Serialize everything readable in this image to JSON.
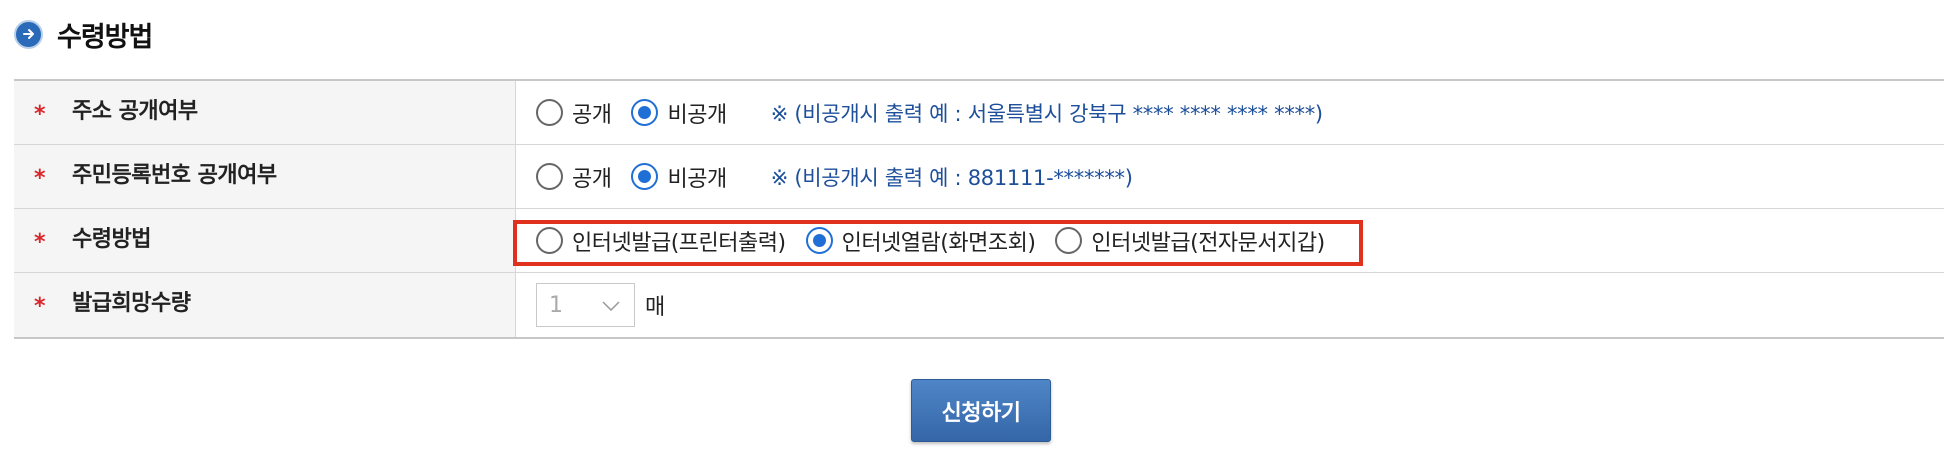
{
  "section": {
    "title": "수령방법"
  },
  "rows": [
    {
      "label": "주소 공개여부",
      "options": [
        "공개",
        "비공개"
      ],
      "selected": 1,
      "note": "※ (비공개시 출력 예 : 서울특별시 강북구 **** **** **** ****)"
    },
    {
      "label": "주민등록번호 공개여부",
      "options": [
        "공개",
        "비공개"
      ],
      "selected": 1,
      "note": "※ (비공개시 출력 예 : 881111-*******)"
    },
    {
      "label": "수령방법",
      "options": [
        "인터넷발급(프린터출력)",
        "인터넷열람(화면조회)",
        "인터넷발급(전자문서지갑)"
      ],
      "selected": 1
    },
    {
      "label": "발급희망수량",
      "quantity": "1",
      "unit": "매"
    }
  ],
  "required_mark": "*",
  "submit_label": "신청하기",
  "colors": {
    "accent": "#1f6fd6",
    "note": "#1e4f9a",
    "highlight": "#e0301e",
    "required": "#d9262a",
    "button": "#3466a8"
  },
  "icons": {
    "title": "arrow-right-circle-icon",
    "select": "chevron-down-icon"
  }
}
